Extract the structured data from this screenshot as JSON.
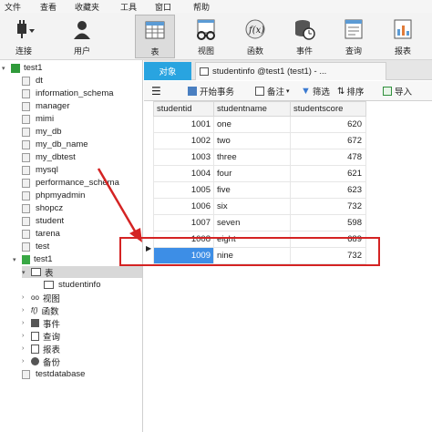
{
  "menu": [
    "文件",
    "查看",
    "收藏夹",
    "工具",
    "窗口",
    "帮助"
  ],
  "toolbar": {
    "connect": "连接",
    "user": "用户",
    "table": "表",
    "view": "视图",
    "function": "函数",
    "event": "事件",
    "query": "查询",
    "report": "报表"
  },
  "tree": {
    "connection": "test1",
    "databases": [
      "dt",
      "information_schema",
      "manager",
      "mimi",
      "my_db",
      "my_db_name",
      "my_dbtest",
      "mysql",
      "performance_schema",
      "phpmyadmin",
      "shopcz",
      "student",
      "tarena",
      "test"
    ],
    "open_db": "test1",
    "tables_node": "表",
    "table_item": "studentinfo",
    "nodes": [
      "视图",
      "函数",
      "事件",
      "查询",
      "报表",
      "备份"
    ],
    "last_db": "testdatabase"
  },
  "tabs": {
    "objects": "对象",
    "studentinfo": "studentinfo @test1 (test1) - ..."
  },
  "subtoolbar": {
    "begin_tx": "开始事务",
    "note": "备注",
    "filter": "筛选",
    "sort": "排序",
    "import": "导入"
  },
  "grid": {
    "columns": [
      "studentid",
      "studentname",
      "studentscore"
    ],
    "rows": [
      [
        "1001",
        "one",
        "620"
      ],
      [
        "1002",
        "two",
        "672"
      ],
      [
        "1003",
        "three",
        "478"
      ],
      [
        "1004",
        "four",
        "621"
      ],
      [
        "1005",
        "five",
        "623"
      ],
      [
        "1006",
        "six",
        "732"
      ],
      [
        "1007",
        "seven",
        "598"
      ],
      [
        "1008",
        "eight",
        "689"
      ]
    ],
    "new_row": [
      "1009",
      "nine",
      "732"
    ]
  },
  "colors": {
    "accent": "#29a4e0",
    "selected_cell": "#3d8ee6",
    "highlight": "#d42323"
  }
}
